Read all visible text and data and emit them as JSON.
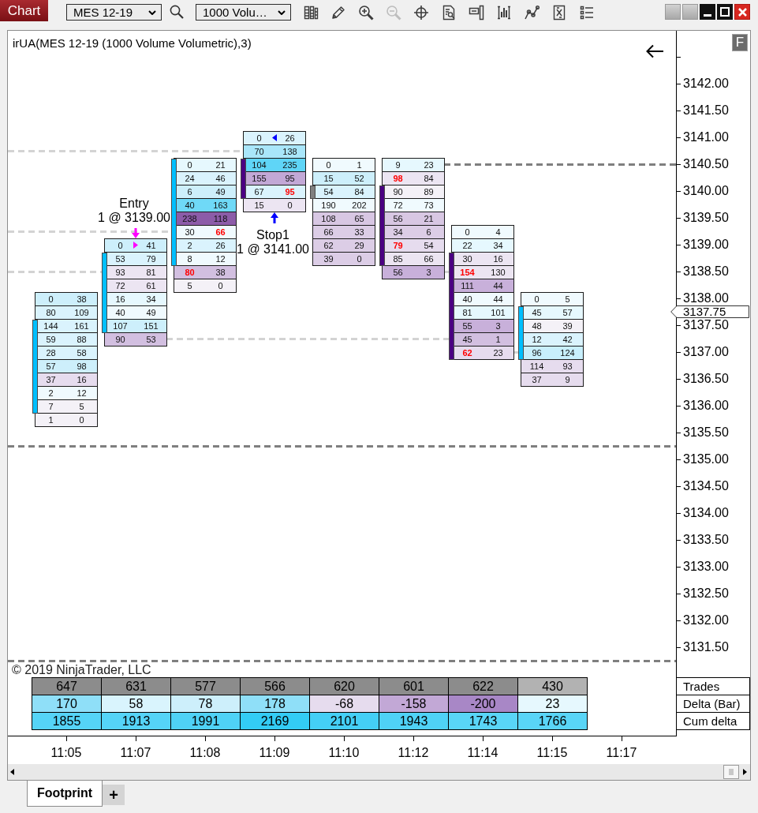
{
  "toolbar": {
    "title": "Chart",
    "instrument": "MES 12-19",
    "interval": "1000 Volu…",
    "tools": [
      {
        "kind": "columns",
        "disabled": false
      },
      {
        "kind": "pencil",
        "disabled": false
      },
      {
        "kind": "zoom_in",
        "disabled": false
      },
      {
        "kind": "zoom_out",
        "disabled": true
      },
      {
        "kind": "crosshair",
        "disabled": false
      },
      {
        "kind": "document_search",
        "disabled": false
      },
      {
        "kind": "panel",
        "disabled": false
      },
      {
        "kind": "bar_chart",
        "disabled": false
      },
      {
        "kind": "line_nodes",
        "disabled": false
      },
      {
        "kind": "document",
        "disabled": false
      },
      {
        "kind": "list",
        "disabled": false
      }
    ],
    "window_buttons": [
      {
        "kind": "blank"
      },
      {
        "kind": "blank"
      },
      {
        "kind": "minimize"
      },
      {
        "kind": "maximize"
      },
      {
        "kind": "close"
      }
    ]
  },
  "chart": {
    "title": "irUA(MES 12-19 (1000 Volume Volumetric),3)",
    "flag_button": "F",
    "copyright": "© 2019 NinjaTrader, LLC",
    "bars": [
      {
        "color": "#00bfff",
        "rows": [
          {
            "bid": "0",
            "ask": "38",
            "color": "#cdeffb",
            "bid_imbalance": false,
            "ask_imbalance": false,
            "strip": false
          },
          {
            "bid": "80",
            "ask": "109",
            "color": "#daf3fd",
            "bid_imbalance": false,
            "ask_imbalance": false,
            "strip": false
          },
          {
            "bid": "144",
            "ask": "161",
            "color": "#daf3fd",
            "bid_imbalance": false,
            "ask_imbalance": false,
            "strip": true
          },
          {
            "bid": "59",
            "ask": "88",
            "color": "#daf3fd",
            "bid_imbalance": false,
            "ask_imbalance": false,
            "strip": true
          },
          {
            "bid": "28",
            "ask": "58",
            "color": "#daf3fd",
            "bid_imbalance": false,
            "ask_imbalance": false,
            "strip": true
          },
          {
            "bid": "57",
            "ask": "98",
            "color": "#cdeffb",
            "bid_imbalance": false,
            "ask_imbalance": false,
            "strip": true
          },
          {
            "bid": "37",
            "ask": "16",
            "color": "#e6dcee",
            "bid_imbalance": false,
            "ask_imbalance": false,
            "strip": true
          },
          {
            "bid": "2",
            "ask": "12",
            "color": "#f0fafe",
            "bid_imbalance": false,
            "ask_imbalance": false,
            "strip": true
          },
          {
            "bid": "7",
            "ask": "5",
            "color": "#f4f1f7",
            "bid_imbalance": false,
            "ask_imbalance": false,
            "strip": true
          },
          {
            "bid": "1",
            "ask": "0",
            "color": "#f4f1f7",
            "bid_imbalance": false,
            "ask_imbalance": false,
            "strip": false
          }
        ]
      },
      {
        "color": "#00bfff",
        "rows": [
          {
            "bid": "0",
            "ask": "41",
            "color": "#cdeffb",
            "bid_imbalance": false,
            "ask_imbalance": false,
            "strip": false,
            "order": {
              "kind": "entry",
              "name": "Entry",
              "detail": "1 @ 3139.00"
            }
          },
          {
            "bid": "53",
            "ask": "79",
            "color": "#daf3fd",
            "bid_imbalance": false,
            "ask_imbalance": false,
            "strip": true
          },
          {
            "bid": "93",
            "ask": "81",
            "color": "#ece5f2",
            "bid_imbalance": false,
            "ask_imbalance": false,
            "strip": true
          },
          {
            "bid": "72",
            "ask": "61",
            "color": "#ece5f2",
            "bid_imbalance": false,
            "ask_imbalance": false,
            "strip": true
          },
          {
            "bid": "16",
            "ask": "34",
            "color": "#e6f8fe",
            "bid_imbalance": false,
            "ask_imbalance": false,
            "strip": true
          },
          {
            "bid": "40",
            "ask": "49",
            "color": "#f0fafe",
            "bid_imbalance": false,
            "ask_imbalance": false,
            "strip": true
          },
          {
            "bid": "107",
            "ask": "151",
            "color": "#cdeffb",
            "bid_imbalance": false,
            "ask_imbalance": false,
            "strip": true
          },
          {
            "bid": "90",
            "ask": "53",
            "color": "#d2bfe0",
            "bid_imbalance": false,
            "ask_imbalance": false,
            "strip": false
          }
        ]
      },
      {
        "color": "#00bfff",
        "rows": [
          {
            "bid": "0",
            "ask": "21",
            "color": "#e6f8fe",
            "bid_imbalance": false,
            "ask_imbalance": false,
            "strip": true
          },
          {
            "bid": "24",
            "ask": "46",
            "color": "#daf3fd",
            "bid_imbalance": false,
            "ask_imbalance": false,
            "strip": true
          },
          {
            "bid": "6",
            "ask": "49",
            "color": "#cdeffb",
            "bid_imbalance": false,
            "ask_imbalance": false,
            "strip": true
          },
          {
            "bid": "40",
            "ask": "163",
            "color": "#6fd9f7",
            "bid_imbalance": false,
            "ask_imbalance": false,
            "strip": true
          },
          {
            "bid": "238",
            "ask": "118",
            "color": "#8c5ca8",
            "bid_imbalance": false,
            "ask_imbalance": false,
            "strip": true
          },
          {
            "bid": "30",
            "ask": "66",
            "color": "#f0fafe",
            "bid_imbalance": false,
            "ask_imbalance": true,
            "strip": true
          },
          {
            "bid": "2",
            "ask": "26",
            "color": "#daf3fd",
            "bid_imbalance": false,
            "ask_imbalance": false,
            "strip": true
          },
          {
            "bid": "8",
            "ask": "12",
            "color": "#f0fafe",
            "bid_imbalance": false,
            "ask_imbalance": false,
            "strip": true
          },
          {
            "bid": "80",
            "ask": "38",
            "color": "#d2bfe0",
            "bid_imbalance": true,
            "ask_imbalance": false,
            "strip": false
          },
          {
            "bid": "5",
            "ask": "0",
            "color": "#f4f1f7",
            "bid_imbalance": false,
            "ask_imbalance": false,
            "strip": false
          }
        ]
      },
      {
        "color": "#4b0082",
        "rows": [
          {
            "bid": "0",
            "ask": "26",
            "color": "#daf3fd",
            "bid_imbalance": false,
            "ask_imbalance": false,
            "strip": false,
            "order": {
              "kind": "stop",
              "name": "Stop1",
              "detail": "1 @ 3141.00"
            }
          },
          {
            "bid": "70",
            "ask": "138",
            "color": "#a9e6fa",
            "bid_imbalance": false,
            "ask_imbalance": false,
            "strip": false
          },
          {
            "bid": "104",
            "ask": "235",
            "color": "#5fd5f7",
            "bid_imbalance": false,
            "ask_imbalance": false,
            "strip": true
          },
          {
            "bid": "155",
            "ask": "95",
            "color": "#c2a8d6",
            "bid_imbalance": false,
            "ask_imbalance": false,
            "strip": true
          },
          {
            "bid": "67",
            "ask": "95",
            "color": "#daf3fd",
            "bid_imbalance": false,
            "ask_imbalance": true,
            "strip": true
          },
          {
            "bid": "15",
            "ask": "0",
            "color": "#ece5f2",
            "bid_imbalance": false,
            "ask_imbalance": false,
            "strip": false
          }
        ]
      },
      {
        "color": "#808080",
        "rows": [
          {
            "bid": "0",
            "ask": "1",
            "color": "#f0fafe",
            "bid_imbalance": false,
            "ask_imbalance": false,
            "strip": false
          },
          {
            "bid": "15",
            "ask": "52",
            "color": "#cdeffb",
            "bid_imbalance": false,
            "ask_imbalance": false,
            "strip": false
          },
          {
            "bid": "54",
            "ask": "84",
            "color": "#daf3fd",
            "bid_imbalance": false,
            "ask_imbalance": false,
            "strip": true
          },
          {
            "bid": "190",
            "ask": "202",
            "color": "#f0fafe",
            "bid_imbalance": false,
            "ask_imbalance": false,
            "strip": false
          },
          {
            "bid": "108",
            "ask": "65",
            "color": "#d8c7e3",
            "bid_imbalance": false,
            "ask_imbalance": false,
            "strip": false
          },
          {
            "bid": "66",
            "ask": "33",
            "color": "#dccde6",
            "bid_imbalance": false,
            "ask_imbalance": false,
            "strip": false
          },
          {
            "bid": "62",
            "ask": "29",
            "color": "#dccde6",
            "bid_imbalance": false,
            "ask_imbalance": false,
            "strip": false
          },
          {
            "bid": "39",
            "ask": "0",
            "color": "#dccde6",
            "bid_imbalance": false,
            "ask_imbalance": false,
            "strip": false
          }
        ]
      },
      {
        "color": "#4b0082",
        "rows": [
          {
            "bid": "9",
            "ask": "23",
            "color": "#e6f8fe",
            "bid_imbalance": false,
            "ask_imbalance": false,
            "strip": false
          },
          {
            "bid": "98",
            "ask": "84",
            "color": "#ece5f2",
            "bid_imbalance": true,
            "ask_imbalance": false,
            "strip": false
          },
          {
            "bid": "90",
            "ask": "89",
            "color": "#f4f1f7",
            "bid_imbalance": false,
            "ask_imbalance": false,
            "strip": true
          },
          {
            "bid": "72",
            "ask": "73",
            "color": "#f0fafe",
            "bid_imbalance": false,
            "ask_imbalance": false,
            "strip": true
          },
          {
            "bid": "56",
            "ask": "21",
            "color": "#d8c7e3",
            "bid_imbalance": false,
            "ask_imbalance": false,
            "strip": true
          },
          {
            "bid": "34",
            "ask": "6",
            "color": "#dccde6",
            "bid_imbalance": false,
            "ask_imbalance": false,
            "strip": true
          },
          {
            "bid": "79",
            "ask": "54",
            "color": "#e6dcee",
            "bid_imbalance": true,
            "ask_imbalance": false,
            "strip": true
          },
          {
            "bid": "85",
            "ask": "66",
            "color": "#ece5f2",
            "bid_imbalance": false,
            "ask_imbalance": false,
            "strip": true
          },
          {
            "bid": "56",
            "ask": "3",
            "color": "#c8b0da",
            "bid_imbalance": false,
            "ask_imbalance": false,
            "strip": false
          }
        ]
      },
      {
        "color": "#4b0082",
        "rows": [
          {
            "bid": "0",
            "ask": "4",
            "color": "#f0fafe",
            "bid_imbalance": false,
            "ask_imbalance": false,
            "strip": false
          },
          {
            "bid": "22",
            "ask": "34",
            "color": "#e6f8fe",
            "bid_imbalance": false,
            "ask_imbalance": false,
            "strip": false
          },
          {
            "bid": "30",
            "ask": "16",
            "color": "#ece5f2",
            "bid_imbalance": false,
            "ask_imbalance": false,
            "strip": true
          },
          {
            "bid": "154",
            "ask": "130",
            "color": "#ece5f2",
            "bid_imbalance": true,
            "ask_imbalance": false,
            "strip": true
          },
          {
            "bid": "111",
            "ask": "44",
            "color": "#c8b0da",
            "bid_imbalance": false,
            "ask_imbalance": false,
            "strip": true
          },
          {
            "bid": "40",
            "ask": "44",
            "color": "#f0fafe",
            "bid_imbalance": false,
            "ask_imbalance": false,
            "strip": true
          },
          {
            "bid": "81",
            "ask": "101",
            "color": "#e6f8fe",
            "bid_imbalance": false,
            "ask_imbalance": false,
            "strip": true
          },
          {
            "bid": "55",
            "ask": "3",
            "color": "#c8b0da",
            "bid_imbalance": false,
            "ask_imbalance": false,
            "strip": true
          },
          {
            "bid": "45",
            "ask": "1",
            "color": "#d2bfe0",
            "bid_imbalance": false,
            "ask_imbalance": false,
            "strip": true
          },
          {
            "bid": "62",
            "ask": "23",
            "color": "#e6dcee",
            "bid_imbalance": true,
            "ask_imbalance": false,
            "strip": true
          }
        ]
      },
      {
        "color": "#00bfff",
        "rows": [
          {
            "bid": "0",
            "ask": "5",
            "color": "#f0fafe",
            "bid_imbalance": false,
            "ask_imbalance": false,
            "strip": false
          },
          {
            "bid": "45",
            "ask": "57",
            "color": "#e6f8fe",
            "bid_imbalance": false,
            "ask_imbalance": false,
            "strip": true
          },
          {
            "bid": "48",
            "ask": "39",
            "color": "#f4f1f7",
            "bid_imbalance": false,
            "ask_imbalance": false,
            "strip": true
          },
          {
            "bid": "12",
            "ask": "42",
            "color": "#daf3fd",
            "bid_imbalance": false,
            "ask_imbalance": false,
            "strip": true
          },
          {
            "bid": "96",
            "ask": "124",
            "color": "#c8effc",
            "bid_imbalance": false,
            "ask_imbalance": false,
            "strip": true
          },
          {
            "bid": "114",
            "ask": "93",
            "color": "#e6dcee",
            "bid_imbalance": false,
            "ask_imbalance": false,
            "strip": false
          },
          {
            "bid": "37",
            "ask": "9",
            "color": "#e6dcee",
            "bid_imbalance": false,
            "ask_imbalance": false,
            "strip": false
          }
        ]
      }
    ],
    "summary": [
      {
        "label": "Trades",
        "cells": [
          {
            "value": "647",
            "color": "#8c8c8c"
          },
          {
            "value": "631",
            "color": "#8c8c8c"
          },
          {
            "value": "577",
            "color": "#8c8c8c"
          },
          {
            "value": "566",
            "color": "#8c8c8c"
          },
          {
            "value": "620",
            "color": "#8c8c8c"
          },
          {
            "value": "601",
            "color": "#8c8c8c"
          },
          {
            "value": "622",
            "color": "#8c8c8c"
          },
          {
            "value": "430",
            "color": "#b2b2b2"
          }
        ]
      },
      {
        "label": "Delta (Bar)",
        "cells": [
          {
            "value": "170",
            "color": "#8fdff8"
          },
          {
            "value": "58",
            "color": "#d9f4fd"
          },
          {
            "value": "78",
            "color": "#cdeffb"
          },
          {
            "value": "178",
            "color": "#8fdff8"
          },
          {
            "value": "-68",
            "color": "#e6dcee"
          },
          {
            "value": "-158",
            "color": "#c2a8d6"
          },
          {
            "value": "-200",
            "color": "#a887c6"
          },
          {
            "value": "23",
            "color": "#e6f8fe"
          }
        ]
      },
      {
        "label": "Cum delta",
        "cells": [
          {
            "value": "1855",
            "color": "#55d4f7"
          },
          {
            "value": "1913",
            "color": "#55d4f7"
          },
          {
            "value": "1991",
            "color": "#4fd2f6"
          },
          {
            "value": "2169",
            "color": "#33ccf5"
          },
          {
            "value": "2101",
            "color": "#44cff6"
          },
          {
            "value": "1943",
            "color": "#4fd2f6"
          },
          {
            "value": "1743",
            "color": "#59d5f7"
          },
          {
            "value": "1766",
            "color": "#59d5f7"
          }
        ]
      }
    ]
  },
  "price_axis": {
    "labels": [
      "3142.00",
      "3141.50",
      "3141.00",
      "3140.50",
      "3140.00",
      "3139.50",
      "3139.00",
      "3138.50",
      "3138.00",
      "3137.50",
      "3137.00",
      "3136.50",
      "3136.00",
      "3135.50",
      "3135.00",
      "3134.50",
      "3134.00",
      "3133.50",
      "3133.00",
      "3132.50",
      "3132.00",
      "3131.50"
    ],
    "current_price": "3137.75"
  },
  "time_axis": {
    "labels": [
      "11:05",
      "11:07",
      "11:08",
      "11:09",
      "11:10",
      "11:12",
      "11:14",
      "11:15",
      "11:17"
    ]
  },
  "tabs": [
    {
      "label": "Footprint",
      "selected": true
    }
  ],
  "add_tab": "+"
}
